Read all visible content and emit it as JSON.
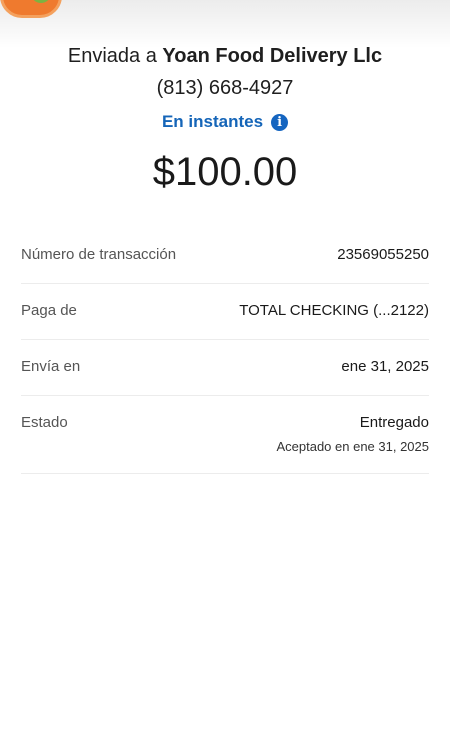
{
  "header": {
    "sent_prefix": "Enviada a",
    "recipient": "Yoan Food Delivery Llc",
    "phone": "(813) 668-4927",
    "speed_label": "En instantes"
  },
  "amount": "$100.00",
  "details": [
    {
      "label": "Número de transacción",
      "value": "23569055250"
    },
    {
      "label": "Paga de",
      "value": "TOTAL CHECKING (...2122)"
    },
    {
      "label": "Envía en",
      "value": "ene 31, 2025"
    },
    {
      "label": "Estado",
      "value": "Entregado",
      "sub": "Aceptado en ene 31, 2025"
    }
  ]
}
